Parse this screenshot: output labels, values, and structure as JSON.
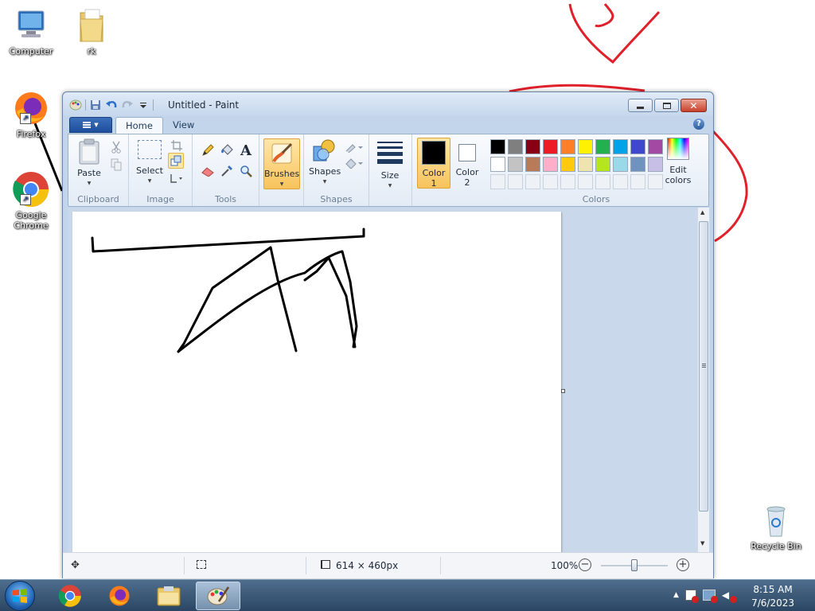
{
  "desktop": {
    "icons": [
      {
        "label": "Computer"
      },
      {
        "label": "rk"
      },
      {
        "label": "Firefox"
      },
      {
        "label": "Google Chrome"
      },
      {
        "label": "Recycle Bin"
      }
    ]
  },
  "window": {
    "title": "Untitled - Paint",
    "tabs": [
      {
        "label": "Home"
      },
      {
        "label": "View"
      }
    ],
    "ribbon": {
      "clipboard": {
        "label": "Clipboard",
        "paste": "Paste"
      },
      "image": {
        "label": "Image",
        "select": "Select"
      },
      "tools": {
        "label": "Tools"
      },
      "brushes": {
        "label": "Brushes"
      },
      "shapes": {
        "label": "Shapes",
        "shapes_btn": "Shapes"
      },
      "size": {
        "label": "Size"
      },
      "color1": {
        "line1": "Color",
        "line2": "1"
      },
      "color2": {
        "line1": "Color",
        "line2": "2"
      },
      "colors": {
        "label": "Colors",
        "edit_line1": "Edit",
        "edit_line2": "colors"
      }
    },
    "palette_row1": [
      "#000000",
      "#7f7f7f",
      "#880015",
      "#ed1c24",
      "#ff7f27",
      "#fff200",
      "#22b14c",
      "#00a2e8",
      "#3f48cc",
      "#a349a4"
    ],
    "palette_row2": [
      "#ffffff",
      "#c3c3c3",
      "#b97a57",
      "#ffaec9",
      "#ffc90e",
      "#efe4b0",
      "#b5e61d",
      "#99d9ea",
      "#7092be",
      "#c8bfe7"
    ],
    "status": {
      "size": "614 × 460px",
      "zoom": "100%"
    }
  },
  "taskbar": {
    "time": "8:15 AM",
    "date": "7/6/2023"
  }
}
